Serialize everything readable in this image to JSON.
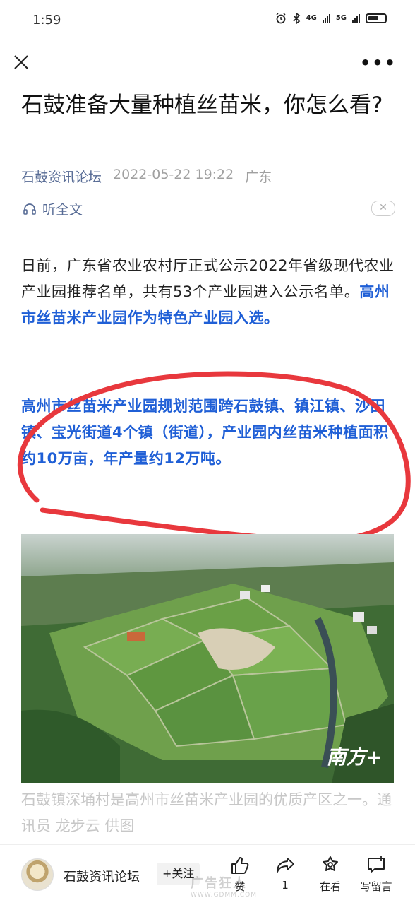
{
  "status_bar": {
    "time": "1:59",
    "network_1": "4G",
    "network_2": "5G"
  },
  "article": {
    "title": "石鼓准备大量种植丝苗米，你怎么看?",
    "author": "石鼓资讯论坛",
    "date": "2022-05-22 19:22",
    "location": "广东",
    "listen_label": "听全文",
    "para1_normal": "日前，广东省农业农村厅正式公示2022年省级现代农业产业园推荐名单，共有53个产业园进入公示名单。",
    "para1_highlight": "高州市丝苗米产业园作为特色产业园入选。",
    "para2": "高州市丝苗米产业园规划范围跨石鼓镇、镇江镇、沙田镇、宝光街道4个镇（街道），产业园内丝苗米种植面积约10万亩，年产量约12万吨。",
    "photo_watermark": "南方+",
    "caption": "石鼓镇深埇村是高州市丝苗米产业园的优质产区之一。通讯员 龙步云 供图"
  },
  "bottom_bar": {
    "author": "石鼓资讯论坛",
    "follow_label": "+关注",
    "like_label": "赞",
    "share_count": "1",
    "wow_label": "在看",
    "comment_label": "写留言"
  },
  "watermark": {
    "main": "广告狂人",
    "sub": "WWW.GDMM.COM"
  },
  "colors": {
    "link": "#576b95",
    "highlight": "#1f5fd6",
    "circle": "#e8383d"
  }
}
